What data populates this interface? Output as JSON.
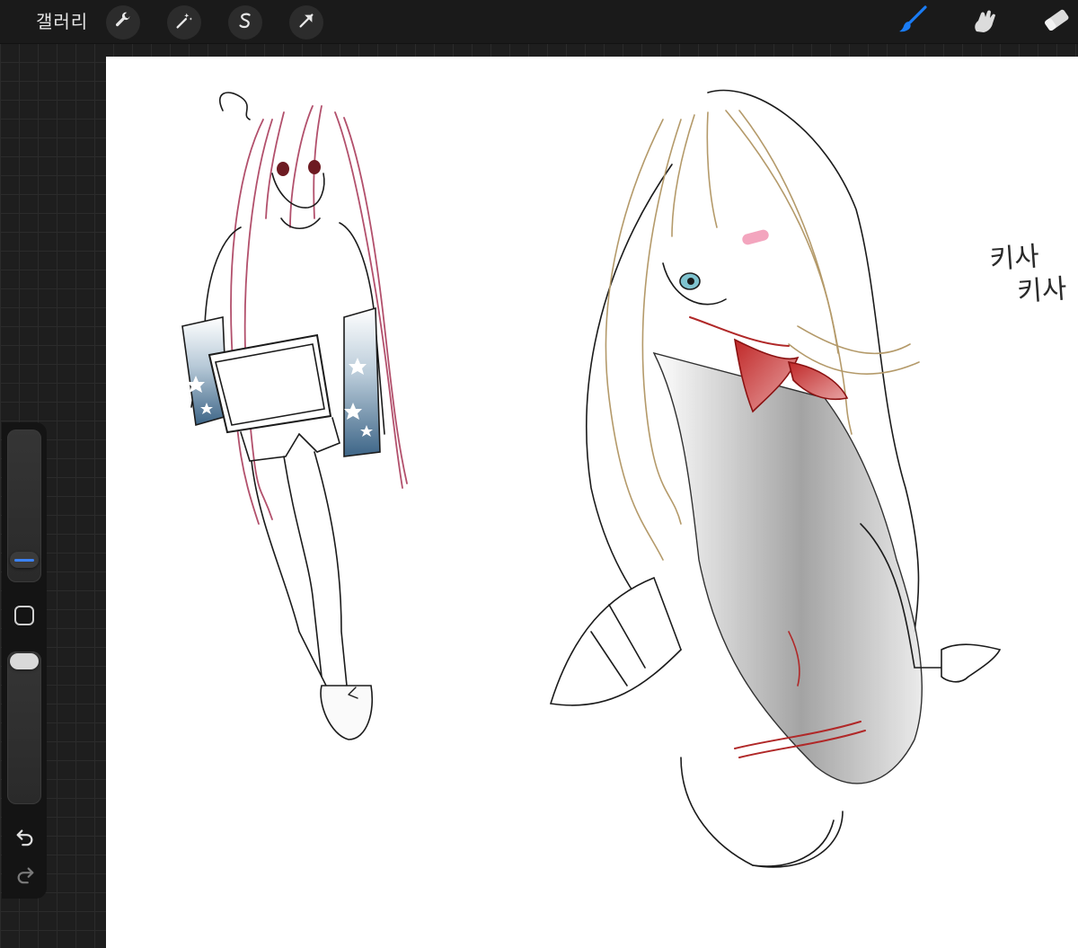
{
  "topbar": {
    "gallery_label": "갤러리",
    "left_tools": [
      {
        "name": "actions",
        "icon": "wrench-icon"
      },
      {
        "name": "adjustments",
        "icon": "magic-wand-icon"
      },
      {
        "name": "selection",
        "icon": "s-selection-icon"
      },
      {
        "name": "transform",
        "icon": "arrow-cursor-icon"
      }
    ],
    "right_tools": [
      {
        "name": "brush",
        "icon": "brush-icon",
        "active": true,
        "color": "#1a7cf5"
      },
      {
        "name": "smudge",
        "icon": "smudge-icon",
        "active": false
      },
      {
        "name": "eraser",
        "icon": "eraser-icon",
        "active": false
      }
    ]
  },
  "sidebar": {
    "brush_size_level": 0.2,
    "opacity_level": 1.0,
    "accent": "#3b82f6",
    "buttons": [
      "modify-icon",
      "undo-icon",
      "redo-icon"
    ]
  },
  "canvas": {
    "background": "#ffffff",
    "note_line1": "키사",
    "note_line2": "키사"
  }
}
